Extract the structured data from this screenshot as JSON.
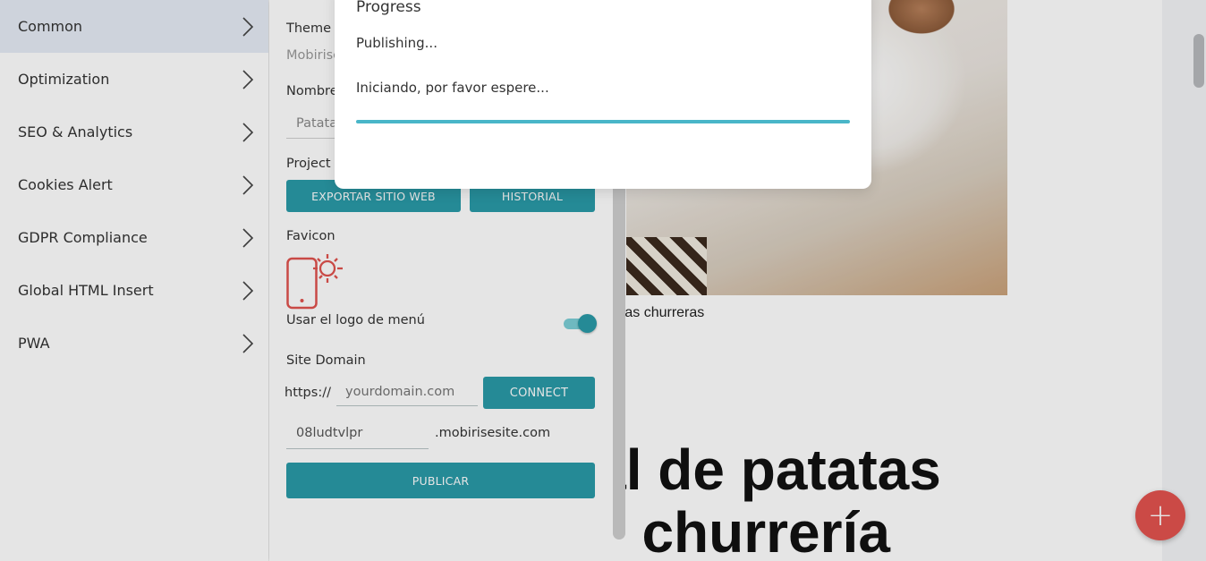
{
  "menu": {
    "items": [
      {
        "label": "Common",
        "active": true
      },
      {
        "label": "Optimization"
      },
      {
        "label": "SEO & Analytics"
      },
      {
        "label": "Cookies Alert"
      },
      {
        "label": "GDPR Compliance"
      },
      {
        "label": "Global HTML Insert"
      },
      {
        "label": "PWA"
      }
    ]
  },
  "panel": {
    "theme_label": "Theme N",
    "theme_value": "Mobirise",
    "site_name_label": "Nombre",
    "site_name_value": "Patata",
    "project_label": "Project P",
    "export_button": "EXPORTAR SITIO WEB",
    "history_button": "HISTORIAL",
    "favicon_label": "Favicon",
    "menu_logo_label": "Usar el logo de menú",
    "menu_logo_enabled": true,
    "site_domain_label": "Site Domain",
    "https_prefix": "https://",
    "domain_placeholder": "yourdomain.com",
    "connect_button": "CONNECT",
    "subdomain_value": "08ludtvlpr",
    "subdomain_suffix": ".mobirisesite.com",
    "publish_button": "PUBLICAR"
  },
  "preview": {
    "caption": "atas churreras",
    "heading_line1": "nal de patatas",
    "heading_line2": "ilo churrería"
  },
  "modal": {
    "title": "Progress",
    "status": "Publishing...",
    "message": "Iniciando, por favor espere..."
  },
  "fab": {
    "label": "+"
  },
  "colors": {
    "accent": "#2a9aa8",
    "fab": "#e2534f",
    "progress": "#49b6c8"
  }
}
